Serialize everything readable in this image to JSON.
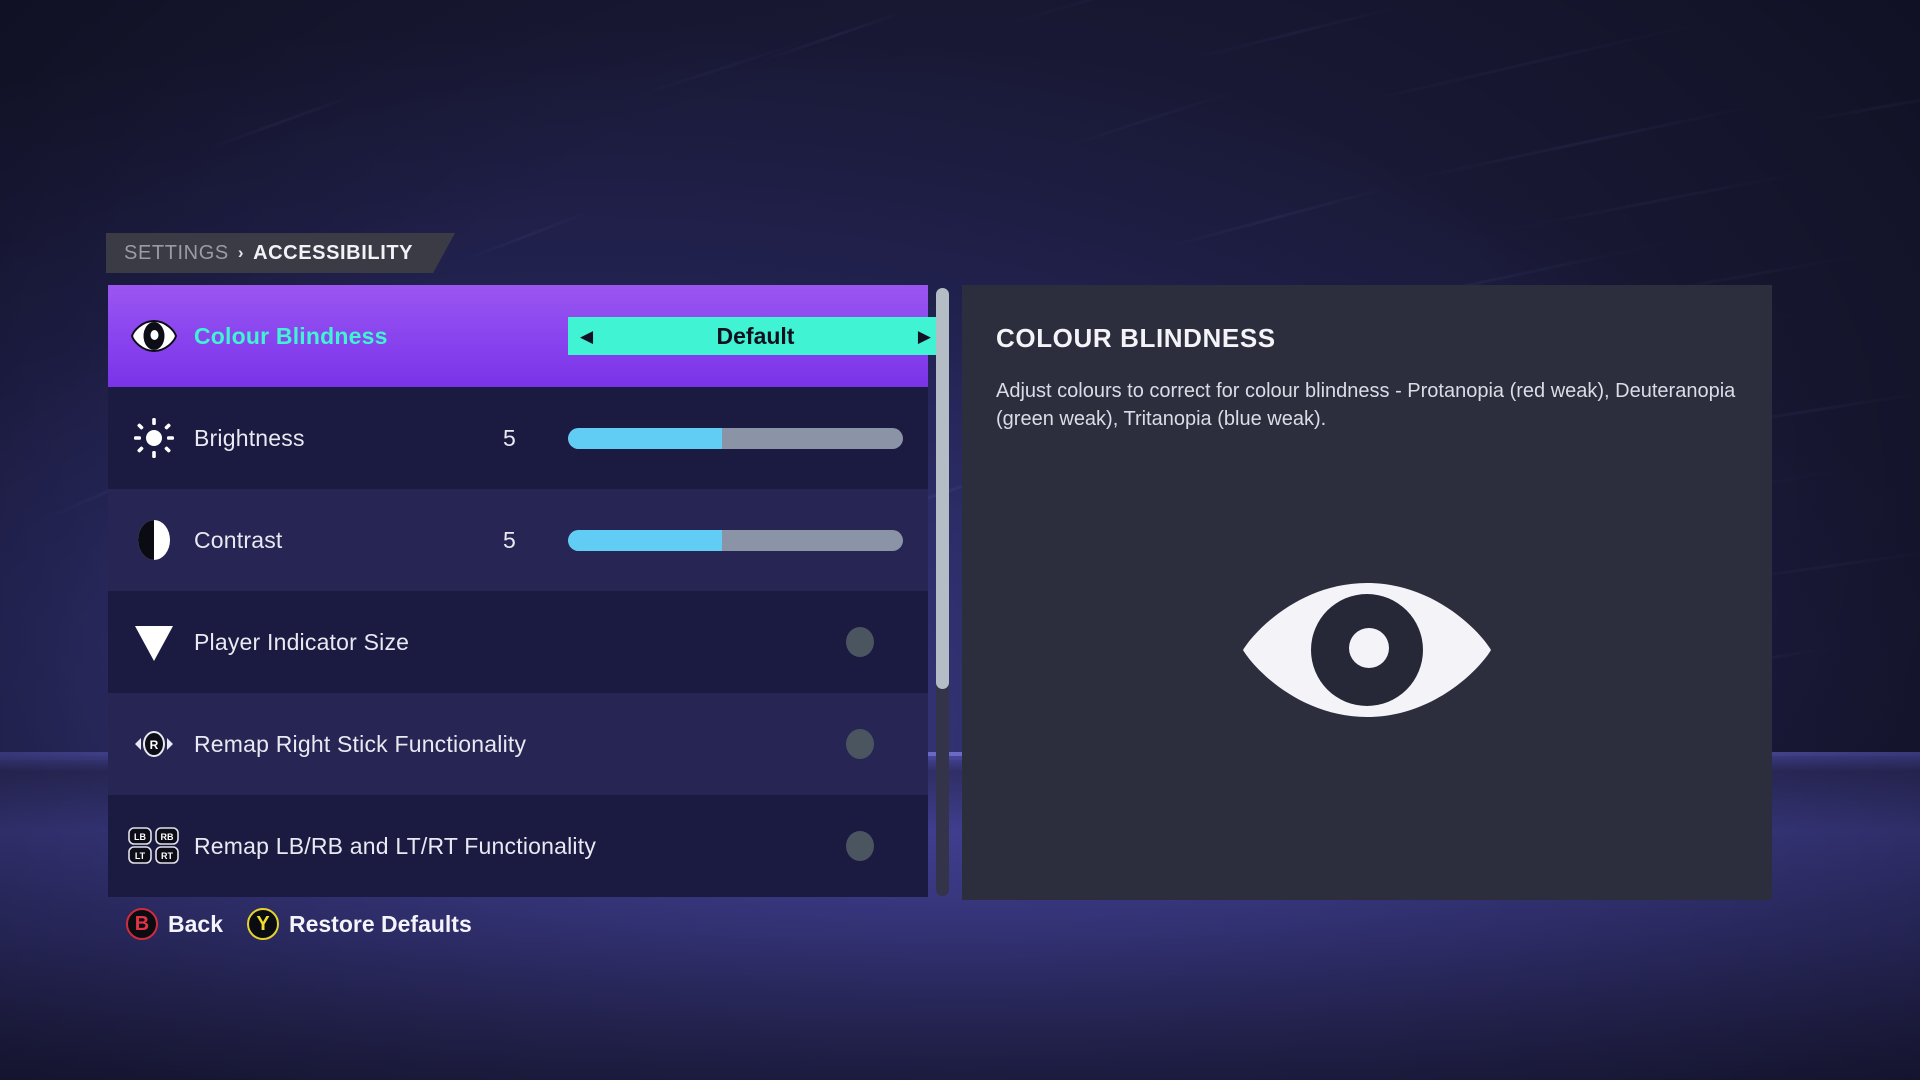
{
  "breadcrumb": {
    "root": "SETTINGS",
    "separator": "›",
    "current": "ACCESSIBILITY"
  },
  "settings_list": {
    "rows": [
      {
        "label": "Colour Blindness",
        "icon": "eye-icon",
        "control": "spinner",
        "value": "Default",
        "left_arrow": "◀",
        "right_arrow": "▶",
        "selected": true
      },
      {
        "label": "Brightness",
        "icon": "brightness-sun-icon",
        "control": "slider",
        "value": "5",
        "fill_percent": 46,
        "selected": false
      },
      {
        "label": "Contrast",
        "icon": "contrast-half-circle-icon",
        "control": "slider",
        "value": "5",
        "fill_percent": 46,
        "selected": false
      },
      {
        "label": "Player Indicator Size",
        "icon": "down-triangle-icon",
        "control": "toggle",
        "selected": false
      },
      {
        "label": "Remap Right Stick Functionality",
        "icon": "right-stick-icon",
        "control": "toggle",
        "selected": false
      },
      {
        "label": "Remap LB/RB and LT/RT Functionality",
        "icon": "shoulder-buttons-icon",
        "control": "toggle",
        "selected": false
      }
    ],
    "scrollbar": {
      "thumb_percent": 66
    }
  },
  "description": {
    "title": "COLOUR BLINDNESS",
    "body": "Adjust colours to correct for colour blindness - Protanopia (red weak), Deuteranopia (green weak), Tritanopia (blue weak).",
    "art_icon": "eye-icon"
  },
  "footer": {
    "hints": [
      {
        "button": "B",
        "label": "Back",
        "color": "#e23446"
      },
      {
        "button": "Y",
        "label": "Restore Defaults",
        "color": "#f1dd2e"
      }
    ]
  },
  "theme": {
    "accent_purple": "#8b46ef",
    "accent_cyan": "#3ff3d3",
    "slider_fill": "#62cdf4",
    "slider_track": "#8b94a6",
    "panel_dark": "#2c2e3d",
    "row_dark": "#1b1b42",
    "row_light": "#262553"
  }
}
